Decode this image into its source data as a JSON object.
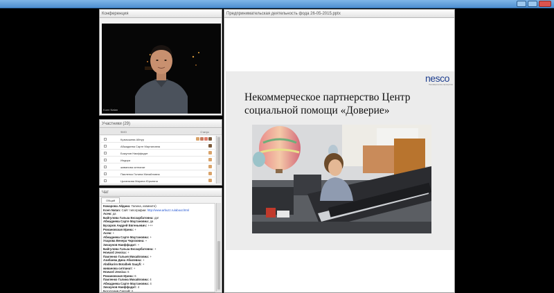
{
  "window": {
    "controls": [
      "minimize-icon",
      "maximize-icon",
      "close-icon"
    ]
  },
  "conference": {
    "title": "Конференция",
    "video_caption": "Koen Natan"
  },
  "participants": {
    "title": "Участники (29)",
    "col_name": "ФИО",
    "col_status": "Статус",
    "rows": [
      "Кузмышева Айнур",
      "Абжадиева Сарте Маутановна",
      "Божунов Наиффадит",
      "Индира",
      "живанова ситпанат",
      "Паиленко Галина Михайловна",
      "Цыганкова Марина Юрьевна"
    ]
  },
  "chat": {
    "title": "Чат",
    "tab": "Общий",
    "lines": [
      {
        "who": "Кожарова Айдана:",
        "text": "Галина, извините)"
      },
      {
        "who": "Koen Natan:",
        "text": "Сайт типографии:",
        "link": "http://www.arbuzz.ru/about.html"
      },
      {
        "who": "Асем:",
        "text": "да"
      },
      {
        "who": "Байгулова Гальза Ексзарбатовна:",
        "text": "да!"
      },
      {
        "who": "Абжадиева Сарте Маутановна:",
        "text": "да"
      },
      {
        "who": "Бухаров Андрей Евгеньевич:",
        "text": "+++"
      },
      {
        "who": "Романовская Ирина:",
        "text": "+"
      },
      {
        "who": "Асем:",
        "text": "+"
      },
      {
        "who": "Абжадиева Сарте Маутановна:",
        "text": "+"
      },
      {
        "who": "Ухарова Венера Чкрозовна:",
        "text": "+"
      },
      {
        "who": "Зихаунов Наиффадит:",
        "text": "+"
      },
      {
        "who": "Байгулова Гальза Ексзарбатовна:",
        "text": "+"
      },
      {
        "who": "Howard Jessica:",
        "text": "+"
      },
      {
        "who": "Паиленко Гальня Михайловна:",
        "text": "+"
      },
      {
        "who": "Азибаева Дина Абилевна:",
        "text": "+"
      },
      {
        "who": "Abdikarim Botalbek Saayfi:",
        "text": "+"
      },
      {
        "who": "живанова ситпанат:",
        "text": "+"
      },
      {
        "who": "Howard Jessica:",
        "text": "6"
      },
      {
        "who": "Романовская Ирина:",
        "text": "6"
      },
      {
        "who": "Паиленко Галина Михайловна:",
        "text": "4"
      },
      {
        "who": "Абжадиева Сарте Маутановна:",
        "text": "4"
      },
      {
        "who": "Зихаунов Наиффадит:",
        "text": "4"
      },
      {
        "who": "Богаторев Сергей:",
        "text": "6"
      },
      {
        "who": "Ухарова Венера Чкрозовна:",
        "text": "6"
      },
      {
        "who": "Abdikarim Botalbek Saayfi:",
        "text": "6"
      }
    ]
  },
  "presentation": {
    "title": "Предпринимательская деятельность фода 26-05-2015.pptx",
    "logo_word": "nesco",
    "logo_tagline": "Некоммерческое партнерство",
    "slide_title": "Некоммерческое партнерство Центр социальной помощи «Доверие»"
  }
}
